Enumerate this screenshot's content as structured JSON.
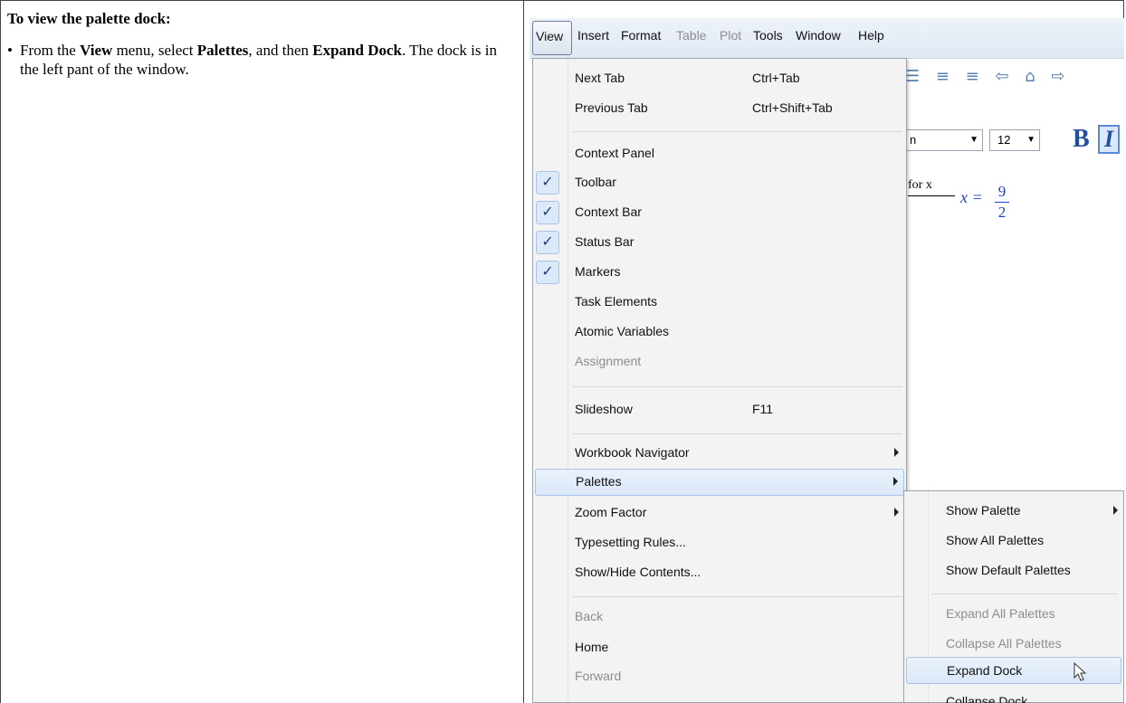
{
  "instructions": {
    "heading": "To view the palette dock:",
    "bullet": "•",
    "text_1": "From the ",
    "bold_view": "View",
    "text_2": " menu, select ",
    "bold_palettes": "Palettes",
    "text_3": ", and then ",
    "bold_expand_dock": "Expand Dock",
    "text_4": ". The dock is in the left pant of the window."
  },
  "menubar": {
    "items": [
      {
        "label": "View",
        "enabled": true,
        "active": true
      },
      {
        "label": "Insert",
        "enabled": true
      },
      {
        "label": "Format",
        "enabled": true
      },
      {
        "label": "Table",
        "enabled": false
      },
      {
        "label": "Plot",
        "enabled": false
      },
      {
        "label": "Tools",
        "enabled": true
      },
      {
        "label": "Window",
        "enabled": true
      },
      {
        "label": "Help",
        "enabled": true
      }
    ]
  },
  "view_menu": {
    "items": [
      {
        "label": "Next Tab",
        "shortcut": "Ctrl+Tab"
      },
      {
        "label": "Previous Tab",
        "shortcut": "Ctrl+Shift+Tab"
      },
      {
        "label": "Context Panel"
      },
      {
        "label": "Toolbar",
        "checked": true
      },
      {
        "label": "Context Bar",
        "checked": true
      },
      {
        "label": "Status Bar",
        "checked": true
      },
      {
        "label": "Markers",
        "checked": true
      },
      {
        "label": "Task Elements"
      },
      {
        "label": "Atomic Variables"
      },
      {
        "label": "Assignment",
        "enabled": false
      },
      {
        "label": "Slideshow",
        "shortcut": "F11"
      },
      {
        "label": "Workbook Navigator",
        "submenu": true
      },
      {
        "label": "Palettes",
        "submenu": true,
        "highlighted": true
      },
      {
        "label": "Zoom Factor",
        "submenu": true
      },
      {
        "label": "Typesetting Rules..."
      },
      {
        "label": "Show/Hide Contents..."
      },
      {
        "label": "Back",
        "enabled": false
      },
      {
        "label": "Home"
      },
      {
        "label": "Forward",
        "enabled": false
      }
    ],
    "check_glyph": "✓"
  },
  "palettes_submenu": {
    "items": [
      {
        "label": "Show Palette",
        "submenu": true
      },
      {
        "label": "Show All Palettes"
      },
      {
        "label": "Show Default Palettes"
      },
      {
        "label": "Expand All Palettes",
        "enabled": false
      },
      {
        "label": "Collapse All Palettes",
        "enabled": false
      },
      {
        "label": "Expand Dock",
        "highlighted": true
      },
      {
        "label": "Collapse Dock"
      }
    ]
  },
  "background": {
    "toolbar_icons": "☰ ≡ ≡ ⇦ ⌂ ⇨",
    "font_combo": "n",
    "size_combo": "12",
    "bold": "B",
    "italic": "I",
    "eq_label": "for x",
    "eq_lhs": "x =",
    "frac_num": "9",
    "frac_den": "2"
  },
  "colors": {
    "menu_highlight": "#dbe8f8",
    "check_bg": "#dce9f9",
    "disabled_text": "#8d8d8d",
    "math_blue": "#1a3fd0"
  }
}
